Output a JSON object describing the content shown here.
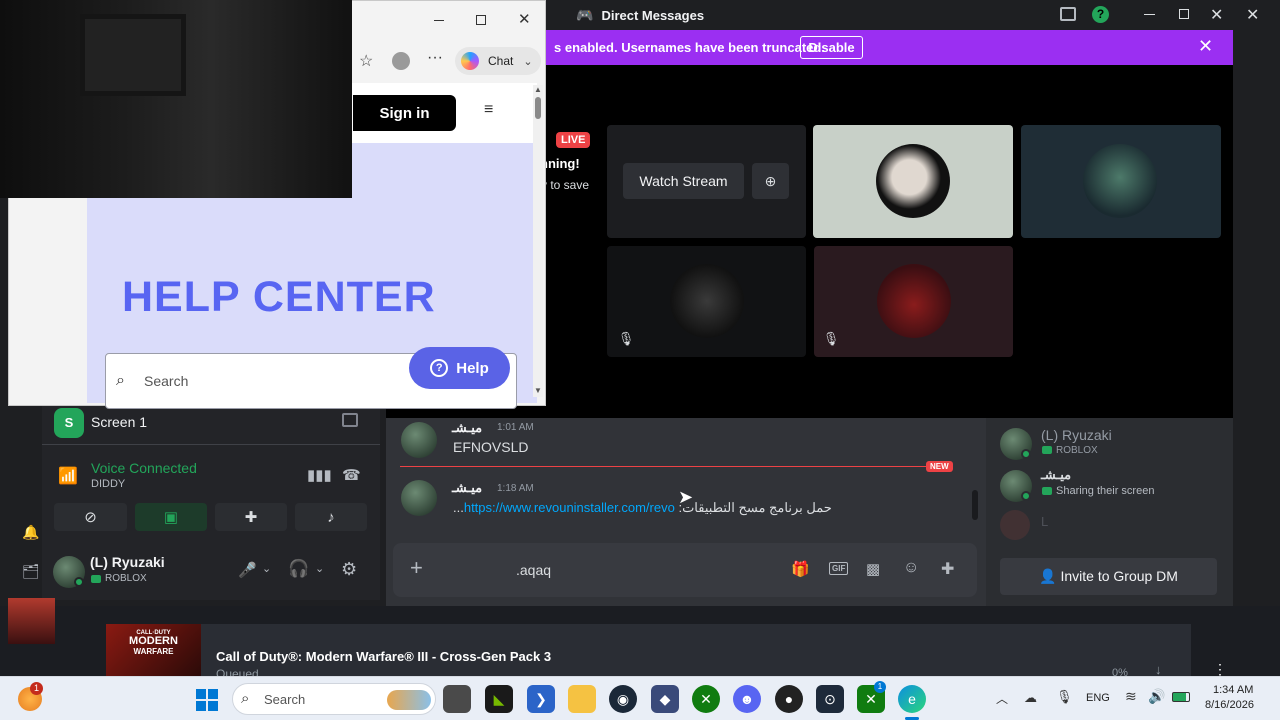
{
  "discord": {
    "window_title": "Direct Messages",
    "banner": {
      "text": "s enabled. Usernames have been truncated.",
      "button": "Disable"
    },
    "call": {
      "live_badge": "LIVE",
      "streaming_text": "nning!",
      "save_text": "v to save",
      "watch_button": "Watch Stream"
    },
    "panel": {
      "screen_label": "Screen 1",
      "voice_status": "Voice Connected",
      "voice_channel": "DIDDY",
      "user_name": "(L) Ryuzaki",
      "user_activity": "ROBLOX"
    },
    "chat": {
      "messages": [
        {
          "author": "ميـشـ",
          "time": "1:01 AM",
          "text": "EFNOVSLD"
        },
        {
          "author": "ميـشـ",
          "time": "1:18 AM",
          "prefix": "...",
          "link": "https://www.revouninstaller.com/revo",
          "rtl_text": "حمل برنامج مسح التطبيقات:"
        }
      ],
      "new_badge": "NEW",
      "composer_text": ".aqaq"
    },
    "members": {
      "items": [
        {
          "name": "(L) Ryuzaki",
          "activity": "ROBLOX"
        },
        {
          "name": "ميـشـ",
          "activity": "Sharing their screen"
        },
        {
          "name": "L",
          "activity": ""
        }
      ],
      "invite_button": "Invite to Group DM"
    }
  },
  "browser": {
    "chat_button": "Chat",
    "sign_in": "Sign in",
    "hero_title": "HELP CENTER",
    "search_placeholder": "Search",
    "help_button": "Help"
  },
  "steam": {
    "game_title": "Call of Duty®: Modern Warfare® III - Cross-Gen Pack 3",
    "status": "Queued",
    "percent": "0%",
    "thumb_line1": "CALL·DUTY",
    "thumb_line2": "MODERN",
    "thumb_line3": "WARFARE"
  },
  "taskbar": {
    "search_placeholder": "Search",
    "notification_count": "1",
    "language": "ENG",
    "time": "1:34 AM",
    "date": "8/16/2026",
    "xbox_badge": "1"
  },
  "colors": {
    "discord_bg": "#1e1f22",
    "banner": "#9b2ff2",
    "blurple": "#5865f2",
    "help_blue": "#5a63e6",
    "live_red": "#ed4245",
    "green": "#23a55a"
  }
}
